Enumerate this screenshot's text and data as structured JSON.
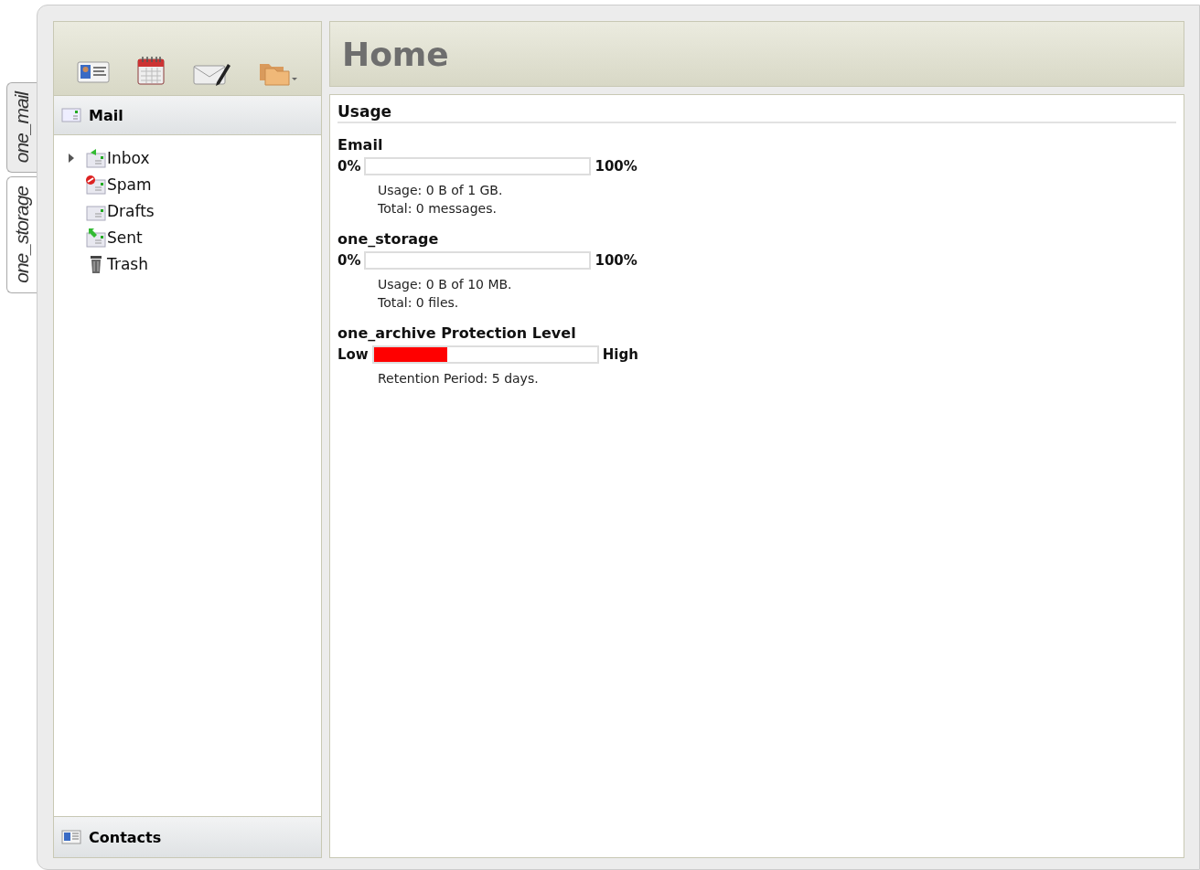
{
  "side_tabs": [
    {
      "label": "one_mail",
      "selected": true
    },
    {
      "label": "one_storage",
      "selected": false
    }
  ],
  "toolbar": {
    "buttons": [
      {
        "kind": "contact"
      },
      {
        "kind": "calendar"
      },
      {
        "kind": "compose"
      },
      {
        "kind": "folders"
      }
    ]
  },
  "mail_panel": {
    "title": "Mail",
    "folders": [
      {
        "label": "Inbox",
        "kind": "inbox",
        "expandable": true
      },
      {
        "label": "Spam",
        "kind": "spam",
        "expandable": false
      },
      {
        "label": "Drafts",
        "kind": "drafts",
        "expandable": false
      },
      {
        "label": "Sent",
        "kind": "sent",
        "expandable": false
      },
      {
        "label": "Trash",
        "kind": "trash",
        "expandable": false
      }
    ]
  },
  "contacts_panel": {
    "title": "Contacts"
  },
  "page": {
    "title": "Home",
    "section": "Usage",
    "meters": [
      {
        "title": "Email",
        "min_label": "0%",
        "max_label": "100%",
        "level": 0,
        "notes": [
          "Usage: 0 B of 1 GB.",
          "Total: 0 messages."
        ]
      },
      {
        "title": "one_storage",
        "min_label": "0%",
        "max_label": "100%",
        "level": 0,
        "notes": [
          "Usage: 0 B of 10 MB.",
          "Total: 0 files."
        ]
      },
      {
        "title": "one_archive Protection Level",
        "min_label": "Low",
        "max_label": "High",
        "level": 0.33,
        "notes": [
          "Retention Period: 5 days."
        ]
      }
    ]
  }
}
